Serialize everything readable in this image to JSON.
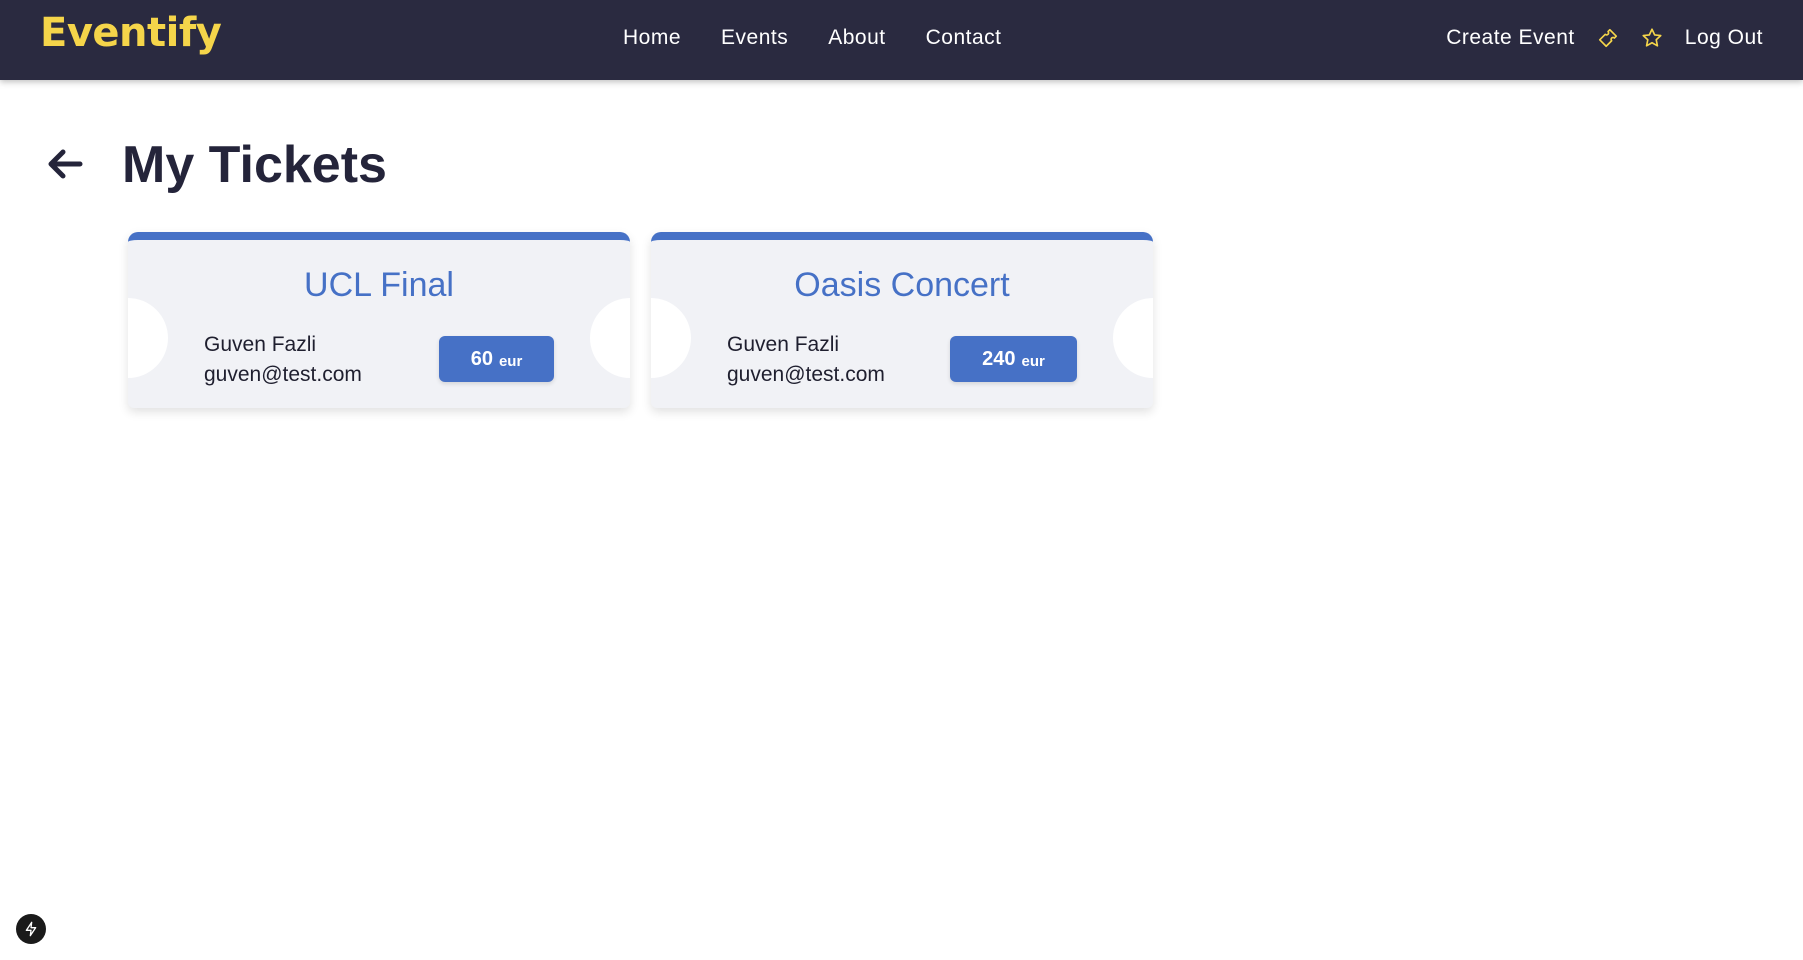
{
  "navbar": {
    "logo": "Eventify",
    "links": [
      "Home",
      "Events",
      "About",
      "Contact"
    ],
    "create_event": "Create Event",
    "ticket_icon": "ticket-icon",
    "favorites_icon": "star-icon",
    "logout": "Log Out"
  },
  "page": {
    "title": "My Tickets",
    "back_icon": "arrow-left-icon"
  },
  "tickets": [
    {
      "event": "UCL Final",
      "name": "Guven Fazli",
      "email": "guven@test.com",
      "price": "60",
      "unit": "eur"
    },
    {
      "event": "Oasis Concert",
      "name": "Guven Fazli",
      "email": "guven@test.com",
      "price": "240",
      "unit": "eur"
    }
  ],
  "colors": {
    "navbar_bg": "#2a2a40",
    "logo": "#f5d54a",
    "accent": "#4671c6",
    "ticket_bg": "#f1f2f6"
  },
  "dev_badge_icon": "lightning-icon"
}
